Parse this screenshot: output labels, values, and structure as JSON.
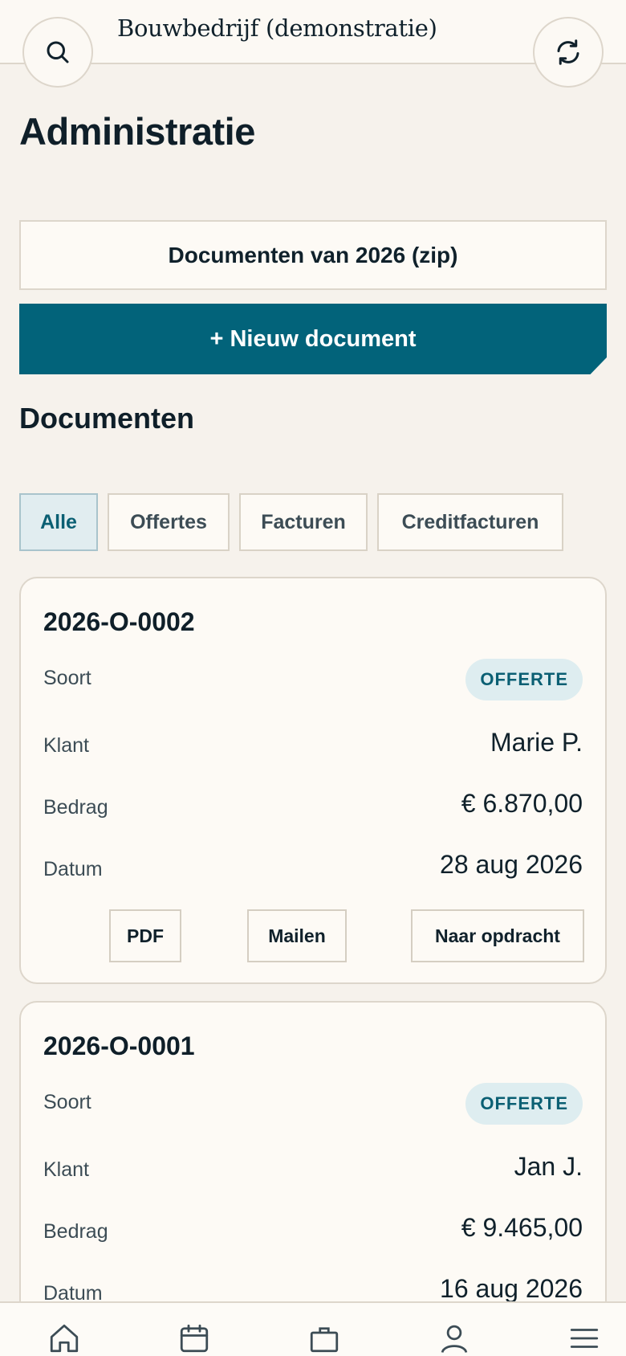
{
  "header": {
    "company": "Bouwbedrijf (demonstratie)",
    "search_icon": "search-icon",
    "refresh_icon": "refresh-icon"
  },
  "page": {
    "title": "Administratie",
    "zip_button": "Documenten van 2026 (zip)",
    "new_button": "+ Nieuw document",
    "section_title": "Documenten"
  },
  "filters": [
    {
      "label": "Alle",
      "active": true
    },
    {
      "label": "Offertes",
      "active": false
    },
    {
      "label": "Facturen",
      "active": false
    },
    {
      "label": "Creditfacturen",
      "active": false
    }
  ],
  "labels": {
    "type": "Soort",
    "client": "Klant",
    "amount": "Bedrag",
    "date": "Datum"
  },
  "documents": [
    {
      "number": "2026-O-0002",
      "type": "OFFERTE",
      "client": "Marie P.",
      "amount": "€ 6.870,00",
      "date": "28 aug 2026",
      "actions": [
        "PDF",
        "Mailen",
        "Naar opdracht"
      ]
    },
    {
      "number": "2026-O-0001",
      "type": "OFFERTE",
      "client": "Jan J.",
      "amount": "€ 9.465,00",
      "date": "16 aug 2026"
    }
  ],
  "bottom_nav": [
    "home-icon",
    "calendar-icon",
    "briefcase-icon",
    "user-icon",
    "menu-icon"
  ],
  "colors": {
    "primary": "#02637a",
    "background": "#f6f2ec",
    "card": "#fdfaf5",
    "badge_bg": "#deedf0"
  }
}
